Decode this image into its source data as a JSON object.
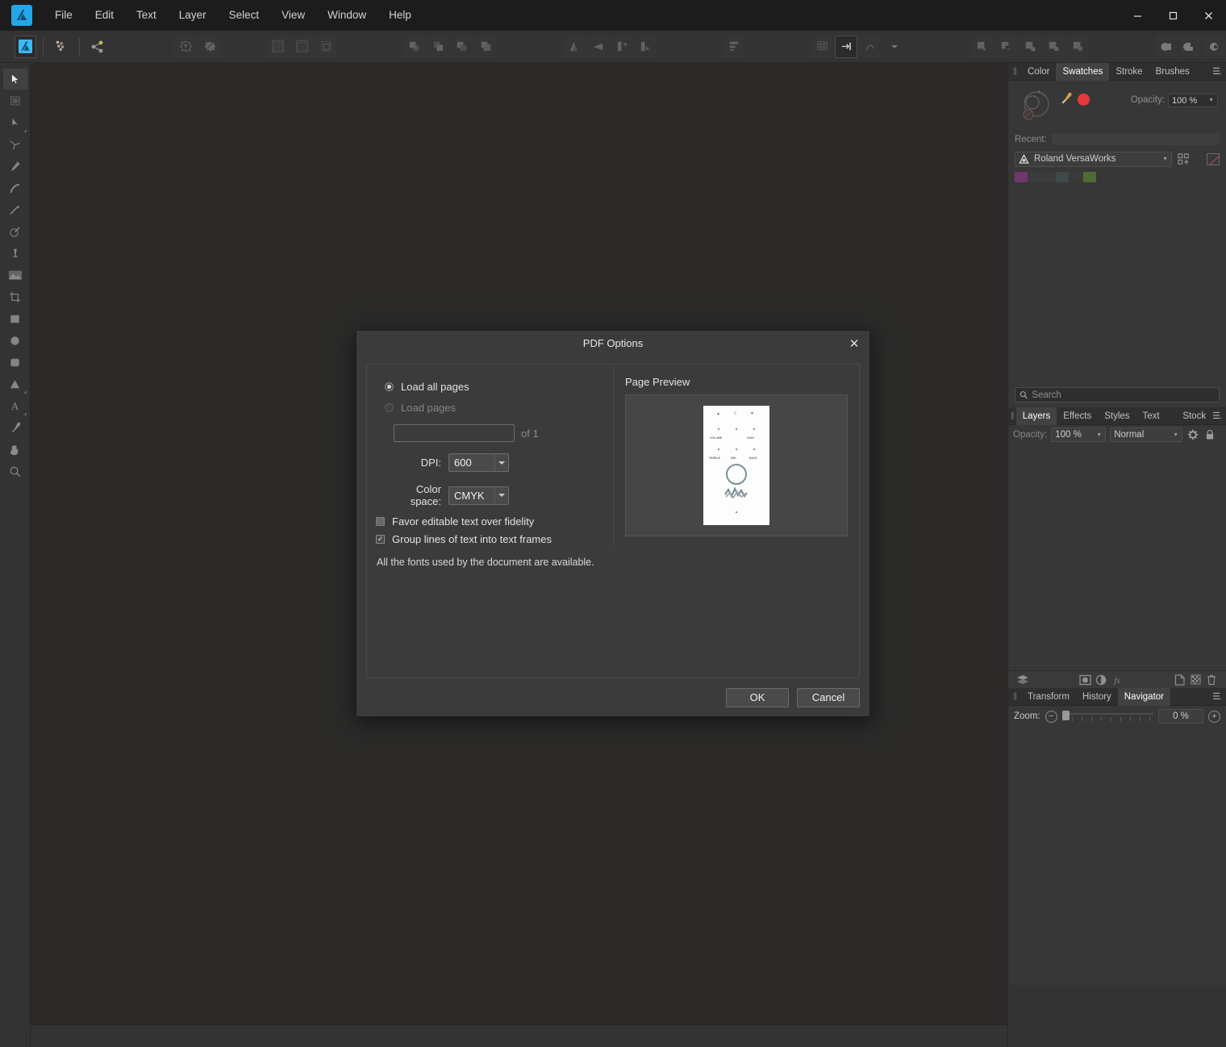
{
  "app": {
    "name": "Affinity Designer",
    "accent": "#26a6e8",
    "window_controls": {
      "minimize": "—",
      "maximize": "❑",
      "close": "✕"
    }
  },
  "menubar": {
    "items": [
      {
        "label": "File"
      },
      {
        "label": "Edit"
      },
      {
        "label": "Text"
      },
      {
        "label": "Layer"
      },
      {
        "label": "Select"
      },
      {
        "label": "View"
      },
      {
        "label": "Window"
      },
      {
        "label": "Help"
      }
    ]
  },
  "toolbar": {
    "groups": [
      {
        "name": "persona",
        "buttons": [
          {
            "icon": "designer-persona-icon",
            "active": true
          },
          {
            "icon": "pixel-persona-icon",
            "active": false
          },
          {
            "icon": "export-persona-icon",
            "active": false
          }
        ]
      },
      {
        "name": "document",
        "buttons": [
          {
            "icon": "new-document-icon",
            "enabled": false
          },
          {
            "icon": "document-setup-icon",
            "enabled": false
          }
        ]
      },
      {
        "name": "grid",
        "buttons": [
          {
            "icon": "show-grid-icon",
            "enabled": false
          },
          {
            "icon": "show-guides-icon",
            "enabled": false
          },
          {
            "icon": "transform-objects-icon",
            "enabled": false
          }
        ]
      },
      {
        "name": "arrange",
        "buttons": [
          {
            "icon": "move-to-front-icon",
            "enabled": false
          },
          {
            "icon": "move-forward-icon",
            "enabled": false
          },
          {
            "icon": "move-backward-icon",
            "enabled": false
          },
          {
            "icon": "move-to-back-icon",
            "enabled": false
          }
        ]
      },
      {
        "name": "flip",
        "buttons": [
          {
            "icon": "flip-horizontal-icon",
            "enabled": false
          },
          {
            "icon": "flip-vertical-icon",
            "enabled": false
          },
          {
            "icon": "rotate-left-icon",
            "enabled": false
          },
          {
            "icon": "rotate-right-icon",
            "enabled": false
          }
        ]
      },
      {
        "name": "align",
        "buttons": [
          {
            "icon": "alignment-icon",
            "enabled": false
          }
        ]
      },
      {
        "name": "snapping",
        "buttons": [
          {
            "icon": "grid-snapping-icon",
            "enabled": false
          },
          {
            "icon": "snapping-toggle-icon",
            "enabled": true
          },
          {
            "icon": "snapping-candidates-icon",
            "enabled": false
          },
          {
            "icon": "snapping-options-caret-icon",
            "enabled": true
          }
        ]
      },
      {
        "name": "geometry",
        "buttons": [
          {
            "icon": "add-shapes-icon",
            "enabled": false
          },
          {
            "icon": "subtract-shapes-icon",
            "enabled": false
          },
          {
            "icon": "intersect-shapes-icon",
            "enabled": false
          },
          {
            "icon": "divide-shapes-icon",
            "enabled": false
          },
          {
            "icon": "combine-shapes-icon",
            "enabled": false
          }
        ]
      },
      {
        "name": "boolean",
        "buttons": [
          {
            "icon": "union-icon",
            "enabled": false
          },
          {
            "icon": "difference-icon",
            "enabled": false
          },
          {
            "icon": "xor-icon",
            "enabled": false
          }
        ]
      }
    ]
  },
  "tools": {
    "items": [
      {
        "name": "move-tool",
        "selected": true,
        "has_flyout": false
      },
      {
        "name": "artboard-tool",
        "selected": false,
        "has_flyout": false
      },
      {
        "name": "node-tool",
        "selected": false,
        "has_flyout": true
      },
      {
        "name": "corner-tool",
        "selected": false,
        "has_flyout": false
      },
      {
        "name": "pen-tool",
        "selected": false,
        "has_flyout": false
      },
      {
        "name": "pencil-tool",
        "selected": false,
        "has_flyout": false
      },
      {
        "name": "vector-brush-tool",
        "selected": false,
        "has_flyout": false
      },
      {
        "name": "fill-tool",
        "selected": false,
        "has_flyout": false
      },
      {
        "name": "transparency-tool",
        "selected": false,
        "has_flyout": false
      },
      {
        "name": "place-image-tool",
        "selected": false,
        "has_flyout": false
      },
      {
        "name": "crop-tool",
        "selected": false,
        "has_flyout": false
      },
      {
        "name": "rectangle-tool",
        "selected": false,
        "has_flyout": false
      },
      {
        "name": "ellipse-tool",
        "selected": false,
        "has_flyout": false
      },
      {
        "name": "rounded-rectangle-tool",
        "selected": false,
        "has_flyout": false
      },
      {
        "name": "triangle-tool",
        "selected": false,
        "has_flyout": true
      },
      {
        "name": "artistic-text-tool",
        "selected": false,
        "has_flyout": true
      },
      {
        "name": "colour-picker-tool",
        "selected": false,
        "has_flyout": false
      },
      {
        "name": "view-tool",
        "selected": false,
        "has_flyout": false
      },
      {
        "name": "zoom-tool",
        "selected": false,
        "has_flyout": false
      }
    ]
  },
  "right_panel": {
    "top_group": {
      "tabs": [
        {
          "label": "Color",
          "active": false
        },
        {
          "label": "Swatches",
          "active": true
        },
        {
          "label": "Stroke",
          "active": false
        },
        {
          "label": "Brushes",
          "active": false
        }
      ],
      "opacity_label": "Opacity:",
      "opacity_value": "100 %",
      "recent_label": "Recent:",
      "palette": {
        "name": "Roland VersaWorks",
        "swatches": [
          "#6f3670",
          "#3c3c3c",
          "#3c3c3c",
          "#3f4a4a",
          "#3a3a3a",
          "#4f6b35"
        ]
      }
    },
    "search": {
      "placeholder": "Search",
      "value": ""
    },
    "layers_group": {
      "tabs": [
        {
          "label": "Layers",
          "active": true
        },
        {
          "label": "Effects",
          "active": false
        },
        {
          "label": "Styles",
          "active": false
        },
        {
          "label": "Text Styles",
          "active": false
        },
        {
          "label": "Stock",
          "active": false
        }
      ],
      "opacity_label": "Opacity:",
      "opacity_value": "100 %",
      "blend_mode": "Normal",
      "footer_icons": [
        "layer-stack-icon",
        "mask-layer-icon",
        "adjustment-layer-icon",
        "layer-effects-icon",
        "add-layer-icon",
        "add-pixel-layer-icon",
        "delete-layer-icon"
      ]
    },
    "bottom_group": {
      "tabs": [
        {
          "label": "Transform",
          "active": false
        },
        {
          "label": "History",
          "active": false
        },
        {
          "label": "Navigator",
          "active": true
        }
      ],
      "zoom_label": "Zoom:",
      "zoom_value": "0 %",
      "zoom_out": "−",
      "zoom_in": "+"
    }
  },
  "dialog": {
    "title": "PDF Options",
    "close_glyph": "✕",
    "load_all_pages": {
      "label": "Load all pages",
      "selected": true
    },
    "load_pages": {
      "label": "Load pages",
      "selected": false,
      "enabled": false
    },
    "page_range": {
      "value": "",
      "suffix": "of 1"
    },
    "dpi": {
      "label": "DPI:",
      "value": "600"
    },
    "color_space": {
      "label": "Color space:",
      "value": "CMYK"
    },
    "favor_editable": {
      "label": "Favor editable text over fidelity",
      "checked": false
    },
    "group_lines": {
      "label": "Group lines of text into text frames",
      "checked": true,
      "check_glyph": "✓"
    },
    "fonts_note": "All the fonts used by the document are available.",
    "preview": {
      "title": "Page Preview",
      "thumbnail_labels": [
        "VOLUME",
        "GAIN",
        "TREBLE",
        "MID",
        "BASS"
      ]
    },
    "buttons": {
      "ok": "OK",
      "cancel": "Cancel"
    }
  }
}
